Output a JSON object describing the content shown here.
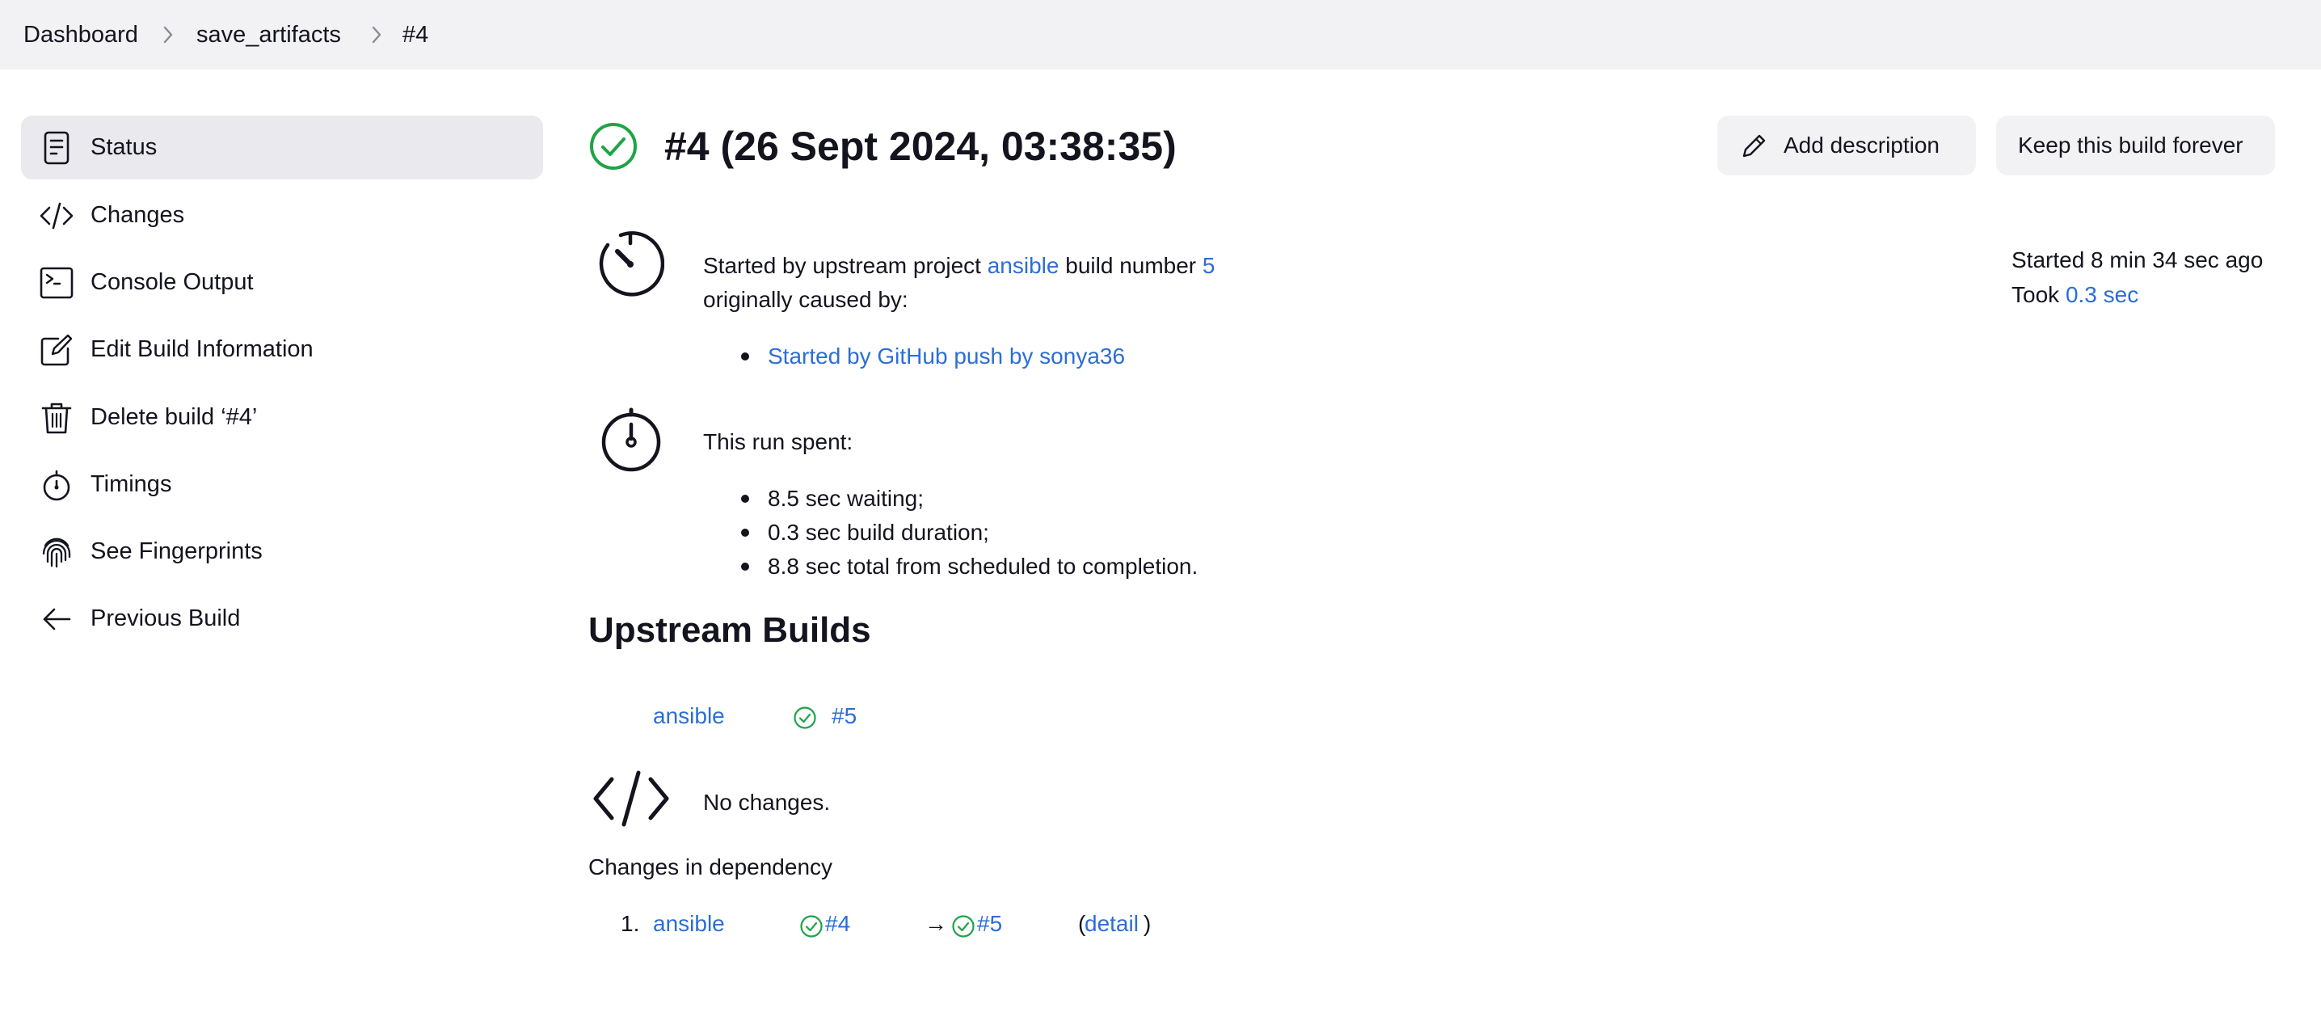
{
  "breadcrumb": {
    "items": [
      "Dashboard",
      "save_artifacts",
      "#4"
    ]
  },
  "sidebar": {
    "items": [
      {
        "label": "Status",
        "icon": "document-icon",
        "active": true
      },
      {
        "label": "Changes",
        "icon": "code-icon"
      },
      {
        "label": "Console Output",
        "icon": "terminal-icon"
      },
      {
        "label": "Edit Build Information",
        "icon": "edit-icon"
      },
      {
        "label": "Delete build ‘#4’",
        "icon": "trash-icon"
      },
      {
        "label": "Timings",
        "icon": "stopwatch-icon"
      },
      {
        "label": "See Fingerprints",
        "icon": "fingerprint-icon"
      },
      {
        "label": "Previous Build",
        "icon": "arrow-left-icon"
      }
    ]
  },
  "header": {
    "title": "#4 (26 Sept 2024, 03:38:35)",
    "status_icon": "success-check-icon",
    "add_description_label": "Add description",
    "keep_forever_label": "Keep this build forever"
  },
  "summary": {
    "started_ago": "Started 8 min 34 sec ago",
    "took_prefix": "Took",
    "took_value": "0.3 sec"
  },
  "cause": {
    "prefix": "Started by upstream project",
    "project": "ansible",
    "middle": "build number",
    "build_number": "5",
    "originally": "originally caused by:",
    "items": [
      "Started by GitHub push by sonya36"
    ]
  },
  "timing": {
    "heading": "This run spent:",
    "items": [
      "8.5 sec waiting;",
      "0.3 sec build duration;",
      "8.8 sec total from scheduled to completion."
    ]
  },
  "upstream": {
    "heading": "Upstream Builds",
    "project": "ansible",
    "build": "#5"
  },
  "changes": {
    "no_changes": "No changes.",
    "dependency_heading": "Changes in dependency",
    "dependency": {
      "index": "1.",
      "project": "ansible",
      "from_build": "#4",
      "arrow": "→",
      "to_build": "#5",
      "open_paren": "(",
      "detail": "detail",
      "close_paren": ")"
    }
  },
  "colors": {
    "accent_link": "#2c6ed6",
    "success": "#1ea446",
    "breadcrumb_bg": "#f2f2f5",
    "active_item_bg": "#e9e9ee"
  }
}
